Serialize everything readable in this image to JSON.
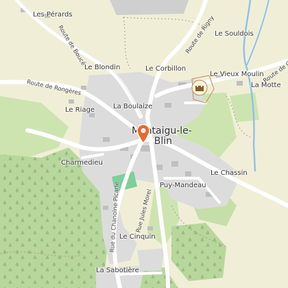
{
  "map": {
    "town": {
      "line1": "Montaigu-le-",
      "line2": "Blin"
    },
    "places": {
      "les_perards": "Les Pérards",
      "le_souldois": "Le Souldois",
      "le_blondin": "Le Blondin",
      "le_corbillon": "Le Corbillon",
      "le_vieux_moulin": "Le Vieux Moulin",
      "la_motte": "La Motte",
      "le_riage": "Le Riage",
      "la_boulaize": "La Boulaize",
      "charmedieu": "Charmedieu",
      "le_chassin": "Le Chassin",
      "puy_mandeau": "Puy-Mandeau",
      "le_cinquin": "Le Cinquin",
      "la_sabotiere": "La Sabotière"
    },
    "roads": {
      "route_de_bouce": "Route de Boucé",
      "route_de_rigny": "Route de Rigny",
      "route_de_rongeres": "Route de Rongères",
      "rue_jules_morel": "Rue Jules Morel",
      "rue_du_chanoine_picarle": "Rue du Chanoine Picarle",
      "route_de_c": "Route de C"
    },
    "colors": {
      "background": "#f1eed8",
      "forest": "#b8d79c",
      "meadow": "#cde4b0",
      "urban": "#dcdcdc",
      "building": "#bfbfbf",
      "road": "#ffffff",
      "water": "#8fc3e6",
      "sport_field": "#7ecf9a",
      "marker": "#e8692e"
    },
    "icons": {
      "marker": "map-pin-icon",
      "castle": "castle-icon",
      "tree": "tree-icon"
    }
  }
}
